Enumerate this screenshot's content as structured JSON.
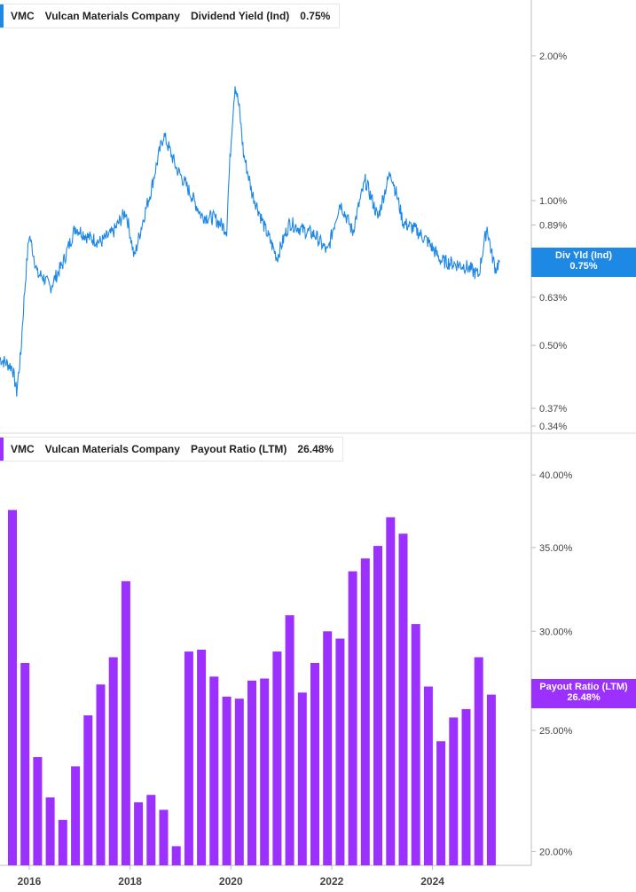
{
  "panels": {
    "top": {
      "ticker": "VMC",
      "company": "Vulcan Materials Company",
      "metric": "Dividend Yield (Ind)",
      "value": "0.75%",
      "color": "#1e88e5",
      "tag_label": "Div Yld (Ind)",
      "tag_value": "0.75%"
    },
    "bottom": {
      "ticker": "VMC",
      "company": "Vulcan Materials Company",
      "metric": "Payout Ratio (LTM)",
      "value": "26.48%",
      "color": "#9b30ff",
      "tag_label": "Payout Ratio (LTM)",
      "tag_value": "26.48%"
    }
  },
  "chart_data": [
    {
      "type": "line",
      "scale": "log",
      "series": [
        {
          "x": [
            "2015-06",
            "2015-09",
            "2015-10",
            "2015-11",
            "2016-01",
            "2016-03",
            "2016-04",
            "2016-06",
            "2016-09",
            "2016-12",
            "2017-03",
            "2017-06",
            "2017-09",
            "2017-12",
            "2018-02",
            "2018-06",
            "2018-09",
            "2018-12",
            "2019-03",
            "2019-06",
            "2019-09",
            "2019-12",
            "2020-02",
            "2020-03",
            "2020-04",
            "2020-06",
            "2020-09",
            "2020-12",
            "2021-03",
            "2021-06",
            "2021-09",
            "2021-12",
            "2022-03",
            "2022-06",
            "2022-09",
            "2022-12",
            "2023-03",
            "2023-06",
            "2023-09",
            "2023-12",
            "2024-03",
            "2024-06",
            "2024-09",
            "2024-12",
            "2025-02",
            "2025-03",
            "2025-04",
            "2025-05"
          ],
          "values": [
            0.47,
            0.45,
            0.4,
            0.48,
            0.85,
            0.7,
            0.7,
            0.66,
            0.74,
            0.88,
            0.84,
            0.82,
            0.86,
            0.95,
            0.76,
            1.05,
            1.37,
            1.17,
            1.05,
            0.93,
            0.92,
            0.87,
            1.75,
            1.55,
            1.25,
            1.04,
            0.88,
            0.76,
            0.9,
            0.87,
            0.85,
            0.78,
            0.99,
            0.86,
            1.1,
            0.92,
            1.15,
            0.9,
            0.87,
            0.82,
            0.75,
            0.74,
            0.73,
            0.7,
            0.88,
            0.78,
            0.72,
            0.75
          ]
        }
      ],
      "yticks": [
        "2.00%",
        "1.00%",
        "0.89%",
        "0.63%",
        "0.50%",
        "0.37%",
        "0.34%"
      ],
      "ylim": [
        0.34,
        2.4
      ]
    },
    {
      "type": "bar",
      "scale": "log",
      "series": [
        {
          "x": [
            "2015-09",
            "2015-12",
            "2016-03",
            "2016-06",
            "2016-09",
            "2016-12",
            "2017-03",
            "2017-06",
            "2017-09",
            "2017-12",
            "2018-03",
            "2018-06",
            "2018-09",
            "2018-12",
            "2019-03",
            "2019-06",
            "2019-09",
            "2019-12",
            "2020-03",
            "2020-06",
            "2020-09",
            "2020-12",
            "2021-03",
            "2021-06",
            "2021-09",
            "2021-12",
            "2022-03",
            "2022-06",
            "2022-09",
            "2022-12",
            "2023-03",
            "2023-06",
            "2023-09",
            "2023-12",
            "2024-03",
            "2024-06",
            "2024-09",
            "2024-12",
            "2025-03"
          ],
          "values": [
            37.5,
            28.3,
            23.8,
            22.1,
            21.2,
            23.4,
            25.7,
            27.2,
            28.6,
            32.9,
            21.9,
            22.2,
            21.6,
            20.2,
            28.9,
            29.0,
            27.6,
            26.6,
            26.5,
            27.4,
            27.5,
            28.9,
            30.9,
            26.8,
            28.3,
            30.0,
            29.6,
            33.5,
            34.3,
            35.1,
            37.0,
            35.9,
            30.4,
            27.1,
            24.5,
            25.6,
            26.0,
            28.6,
            26.7
          ]
        }
      ],
      "yticks": [
        "40.00%",
        "35.00%",
        "30.00%",
        "25.00%",
        "20.00%"
      ],
      "ylim": [
        19.5,
        42.5
      ]
    }
  ],
  "x_axis_labels": [
    "2016",
    "2018",
    "2020",
    "2022",
    "2024"
  ]
}
